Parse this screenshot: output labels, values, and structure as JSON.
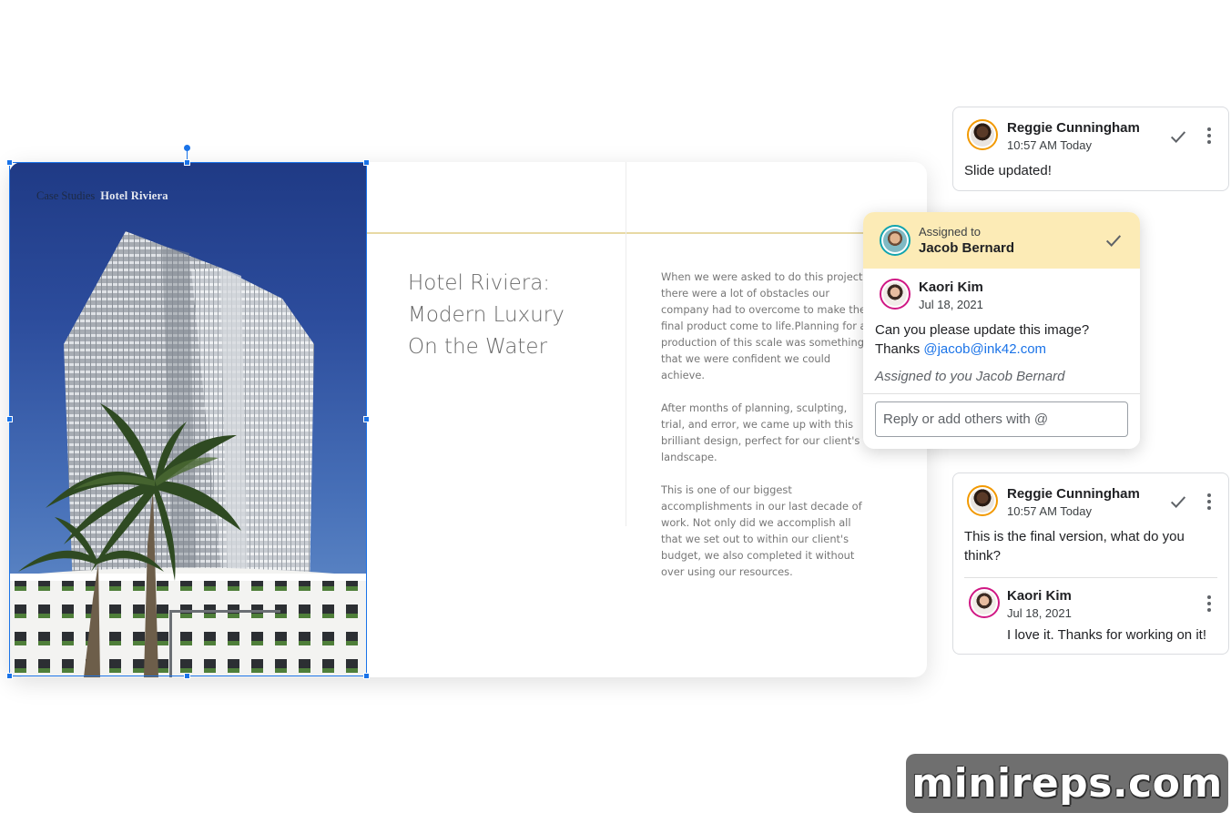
{
  "slide": {
    "caption_section": "Case Studies",
    "caption_title": "Hotel Riviera",
    "title_lines": [
      "Hotel Riviera:",
      "Modern Luxury",
      "On the Water"
    ],
    "paragraphs": [
      "When we were asked to do this project, there were a lot of obstacles our company had to overcome to make the final product come to life.Planning for a production of this scale was something that we were confident we could achieve.",
      "After months of planning, sculpting, trial, and error, we came up with this brilliant design, perfect for our client's landscape.",
      "This is one of our biggest accomplishments in our last decade of work. Not only did we accomplish all that we set out to within our client's budget, we also completed it without over using our resources."
    ]
  },
  "comments": {
    "top": {
      "author": "Reggie Cunningham",
      "time": "10:57 AM Today",
      "message": "Slide updated!"
    },
    "assigned": {
      "assigned_label": "Assigned to",
      "assignee": "Jacob Bernard",
      "author": "Kaori Kim",
      "date": "Jul 18, 2021",
      "message_line1": "Can you please update this image?",
      "message_thanks": "Thanks ",
      "mention": "@jacob@ink42.com",
      "assigned_note": "Assigned to you Jacob Bernard",
      "reply_placeholder": "Reply or add others with @"
    },
    "bottom": {
      "author": "Reggie Cunningham",
      "time": "10:57 AM Today",
      "message": "This is the final version, what do you think?",
      "reply": {
        "author": "Kaori Kim",
        "date": "Jul 18, 2021",
        "message": "I love it. Thanks for working on it!"
      }
    }
  },
  "watermark": "minireps.com",
  "colors": {
    "accent": "#1a73e8",
    "assigned_bg": "#fcebb6",
    "reggie_ring": "#f29900",
    "kaori_ring": "#d01884",
    "jacob_ring": "#12a4af"
  }
}
